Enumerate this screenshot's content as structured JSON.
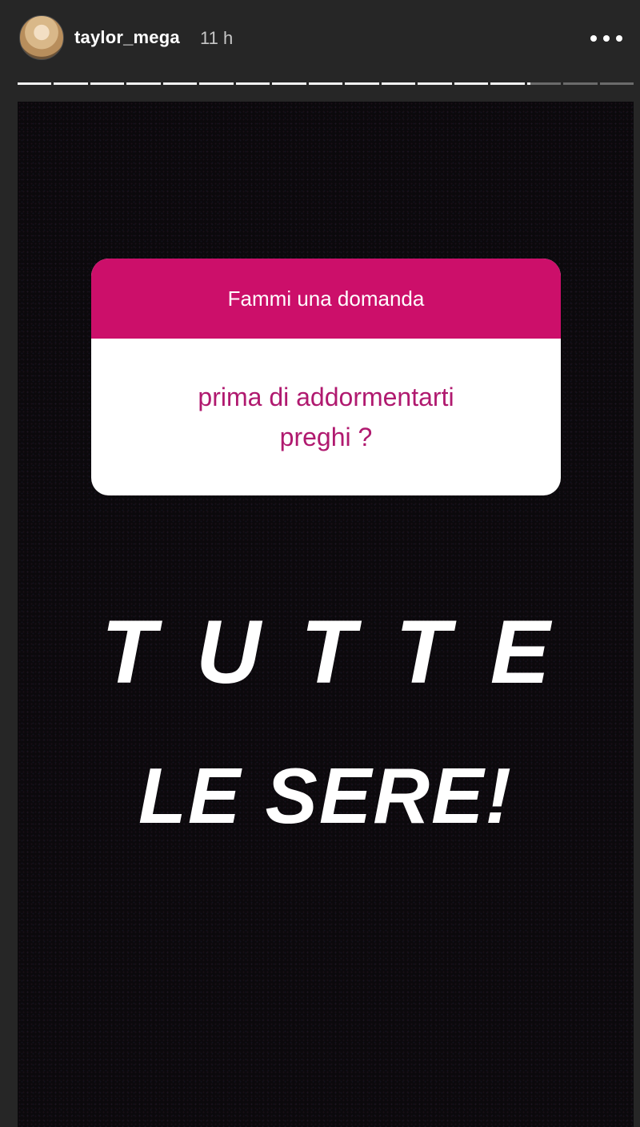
{
  "header": {
    "username": "taylor_mega",
    "timestamp": "11 h",
    "more_icon": "more-horizontal-icon"
  },
  "progress": {
    "segment_count": 17,
    "completed_segments": 14,
    "current_segment_fraction": 0.1
  },
  "question_sticker": {
    "prompt": "Fammi una domanda",
    "question_line1": "prima di addormentarti",
    "question_line2": "preghi ?",
    "header_color": "#cc0f6a",
    "text_color": "#b0196f"
  },
  "answer": {
    "line1": "TUTTE",
    "line2": "LE SERE!"
  }
}
